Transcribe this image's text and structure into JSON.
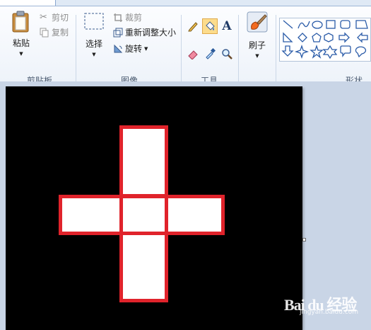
{
  "ribbon": {
    "groups": {
      "clipboard": "剪贴板",
      "image": "图像",
      "tools": "工具",
      "shapes": "形状"
    },
    "clipboard": {
      "paste": "粘贴",
      "cut": "剪切",
      "copy": "复制"
    },
    "image": {
      "select": "选择",
      "crop": "裁剪",
      "resize": "重新调整大小",
      "rotate": "旋转"
    },
    "tools": {
      "text_glyph": "A",
      "selected_tool": "fill-with-color"
    },
    "brushes": {
      "label": "刷子"
    }
  },
  "watermark": {
    "logo_text": "Bai du 经验",
    "url": "jingyan.baidu.com"
  },
  "colors": {
    "canvas": "#000000",
    "shape_fill": "#ffffff",
    "shape_outline": "#e0232b",
    "selected_tool": "#fcdc8c"
  }
}
